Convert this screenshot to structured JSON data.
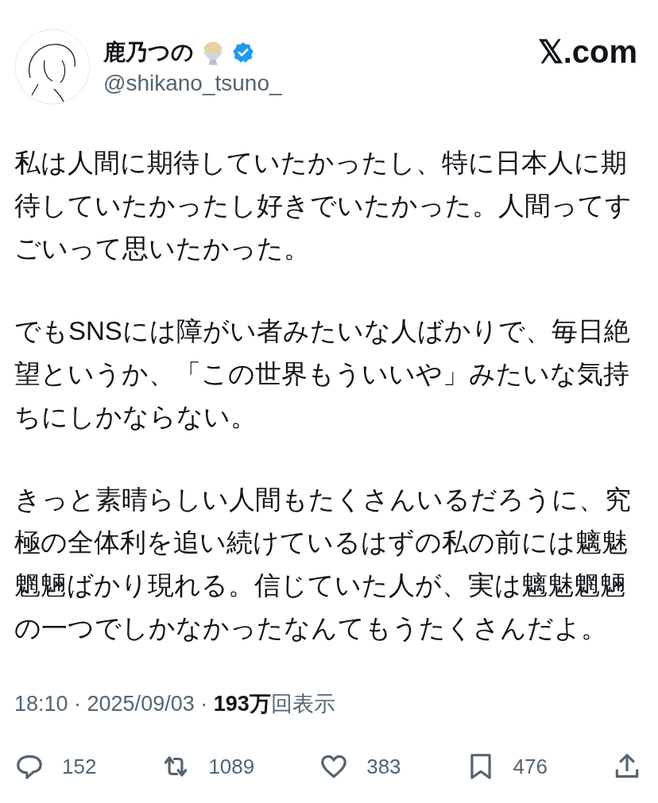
{
  "author": {
    "name": "鹿乃つの",
    "verified": true,
    "handle": "@shikano_tsuno_"
  },
  "site": "𝕏.com",
  "paragraphs": [
    "私は人間に期待していたかったし、特に日本人に期待していたかったし好きでいたかった。人間ってすごいって思いたかった。",
    "でもSNSには障がい者みたいな人ばかりで、毎日絶望というか、「この世界もういいや」みたいな気持ちにしかならない。",
    "きっと素晴らしい人間もたくさんいるだろうに、究極の全体利を追い続けているはずの私の前には魑魅魍魎ばかり現れる。信じていた人が、実は魑魅魍魎の一つでしかなかったなんてもうたくさんだよ。"
  ],
  "meta": "18:10 · 2025/09/03 · **193万**回表示",
  "actions": [
    {
      "kind": "reply",
      "count": "152"
    },
    {
      "kind": "repost",
      "count": "1089"
    },
    {
      "kind": "like",
      "count": "383"
    },
    {
      "kind": "bookmark",
      "count": "476"
    },
    {
      "kind": "share"
    }
  ]
}
